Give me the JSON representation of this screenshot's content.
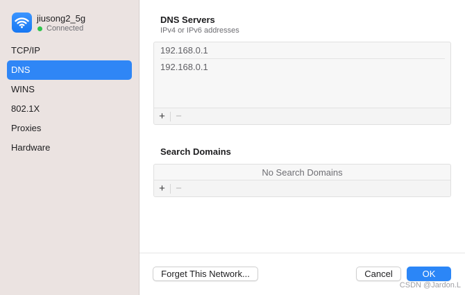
{
  "network": {
    "name": "jiusong2_5g",
    "status": "Connected",
    "icon": "wifi-icon",
    "status_color": "#2fc54c",
    "badge_color": "#1d7cf4"
  },
  "sidebar": {
    "items": [
      {
        "label": "TCP/IP",
        "active": false
      },
      {
        "label": "DNS",
        "active": true
      },
      {
        "label": "WINS",
        "active": false
      },
      {
        "label": "802.1X",
        "active": false
      },
      {
        "label": "Proxies",
        "active": false
      },
      {
        "label": "Hardware",
        "active": false
      }
    ],
    "accent": "#2f86f6"
  },
  "dns": {
    "title": "DNS Servers",
    "subtitle": "IPv4 or IPv6 addresses",
    "servers": [
      "192.168.0.1",
      "192.168.0.1"
    ],
    "add_label": "+",
    "remove_label": "−"
  },
  "search_domains": {
    "title": "Search Domains",
    "empty_text": "No Search Domains",
    "add_label": "+",
    "remove_label": "−"
  },
  "footer": {
    "forget_label": "Forget This Network...",
    "cancel_label": "Cancel",
    "ok_label": "OK"
  },
  "watermark": "CSDN @Jardon.L"
}
